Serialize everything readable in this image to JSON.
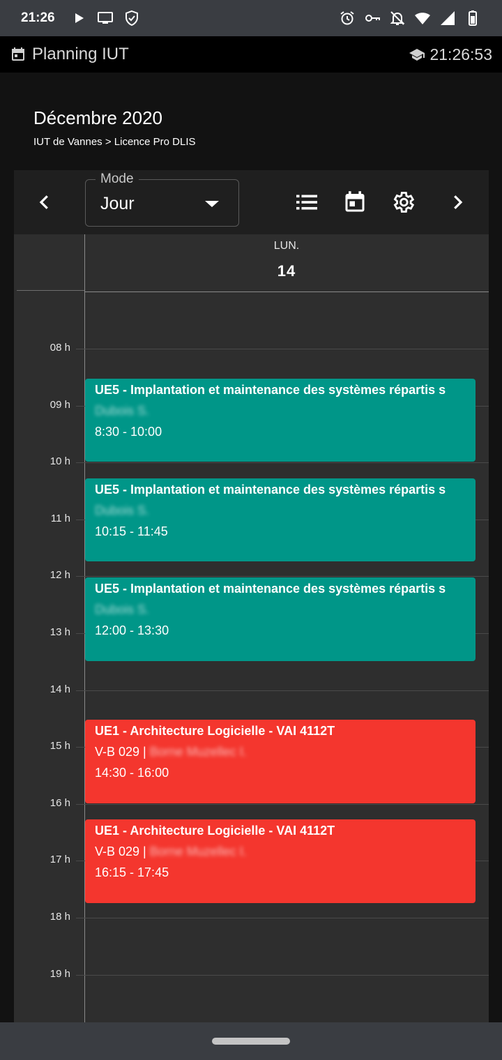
{
  "status_bar": {
    "time": "21:26",
    "left_icons": [
      "play-icon",
      "monitor-icon",
      "shield-icon"
    ],
    "right_icons": [
      "alarm-icon",
      "key-icon",
      "notifications-off-icon",
      "wifi-icon",
      "signal-icon",
      "battery-icon"
    ]
  },
  "app_bar": {
    "title": "Planning IUT",
    "clock": "21:26:53",
    "icons": [
      "calendar-app-icon",
      "school-icon"
    ]
  },
  "header": {
    "month": "Décembre 2020",
    "breadcrumb": "IUT de Vannes > Licence Pro DLIS"
  },
  "toolbar": {
    "mode_label": "Mode",
    "mode_value": "Jour",
    "icons": [
      "chevron-left-icon",
      "list-icon",
      "calendar-icon",
      "settings-icon",
      "chevron-right-icon"
    ]
  },
  "day": {
    "name": "LUN.",
    "number": "14"
  },
  "hours": [
    "08 h",
    "09 h",
    "10 h",
    "11 h",
    "12 h",
    "13 h",
    "14 h",
    "15 h",
    "16 h",
    "17 h",
    "18 h",
    "19 h"
  ],
  "events": [
    {
      "title": "UE5 - Implantation et maintenance des systèmes répartis s",
      "line2": "Dubois S.",
      "line2_prefix": "",
      "time": "8:30 - 10:00",
      "color": "#009688"
    },
    {
      "title": "UE5 - Implantation et maintenance des systèmes répartis s",
      "line2": "Dubois S.",
      "line2_prefix": "",
      "time": "10:15 - 11:45",
      "color": "#009688"
    },
    {
      "title": "UE5 - Implantation et maintenance des systèmes répartis s",
      "line2": "Dubois S.",
      "line2_prefix": "",
      "time": "12:00 - 13:30",
      "color": "#009688"
    },
    {
      "title": "UE1 - Architecture Logicielle - VAI 4112T",
      "line2": "Borne Muzellec I.",
      "line2_prefix": "V-B 029 |",
      "time": "14:30 - 16:00",
      "color": "#f4362e"
    },
    {
      "title": "UE1 - Architecture Logicielle - VAI 4112T",
      "line2": "Borne Muzellec I.",
      "line2_prefix": "V-B 029 |",
      "time": "16:15 - 17:45",
      "color": "#f4362e"
    }
  ]
}
